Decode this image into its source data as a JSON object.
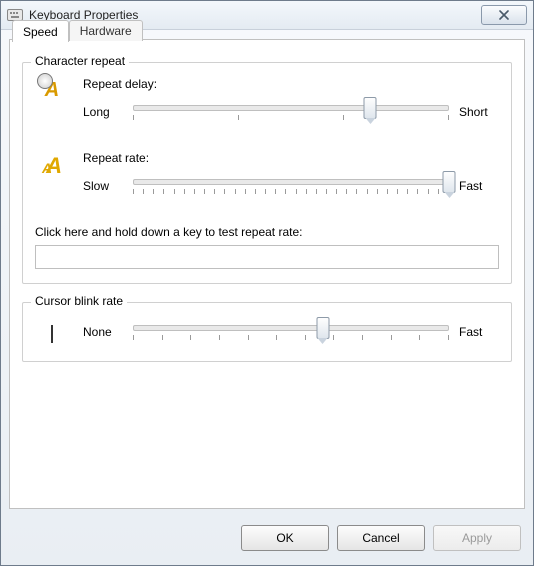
{
  "window": {
    "title": "Keyboard Properties"
  },
  "tabs": {
    "speed": "Speed",
    "hardware": "Hardware"
  },
  "char_repeat": {
    "group_title": "Character repeat",
    "delay": {
      "label": "Repeat delay:",
      "left": "Long",
      "right": "Short",
      "value_percent": 75
    },
    "rate": {
      "label": "Repeat rate:",
      "left": "Slow",
      "right": "Fast",
      "value_percent": 100
    },
    "test_label": "Click here and hold down a key to test repeat rate:",
    "test_value": ""
  },
  "cursor": {
    "group_title": "Cursor blink rate",
    "left": "None",
    "right": "Fast",
    "value_percent": 60
  },
  "buttons": {
    "ok": "OK",
    "cancel": "Cancel",
    "apply": "Apply"
  }
}
